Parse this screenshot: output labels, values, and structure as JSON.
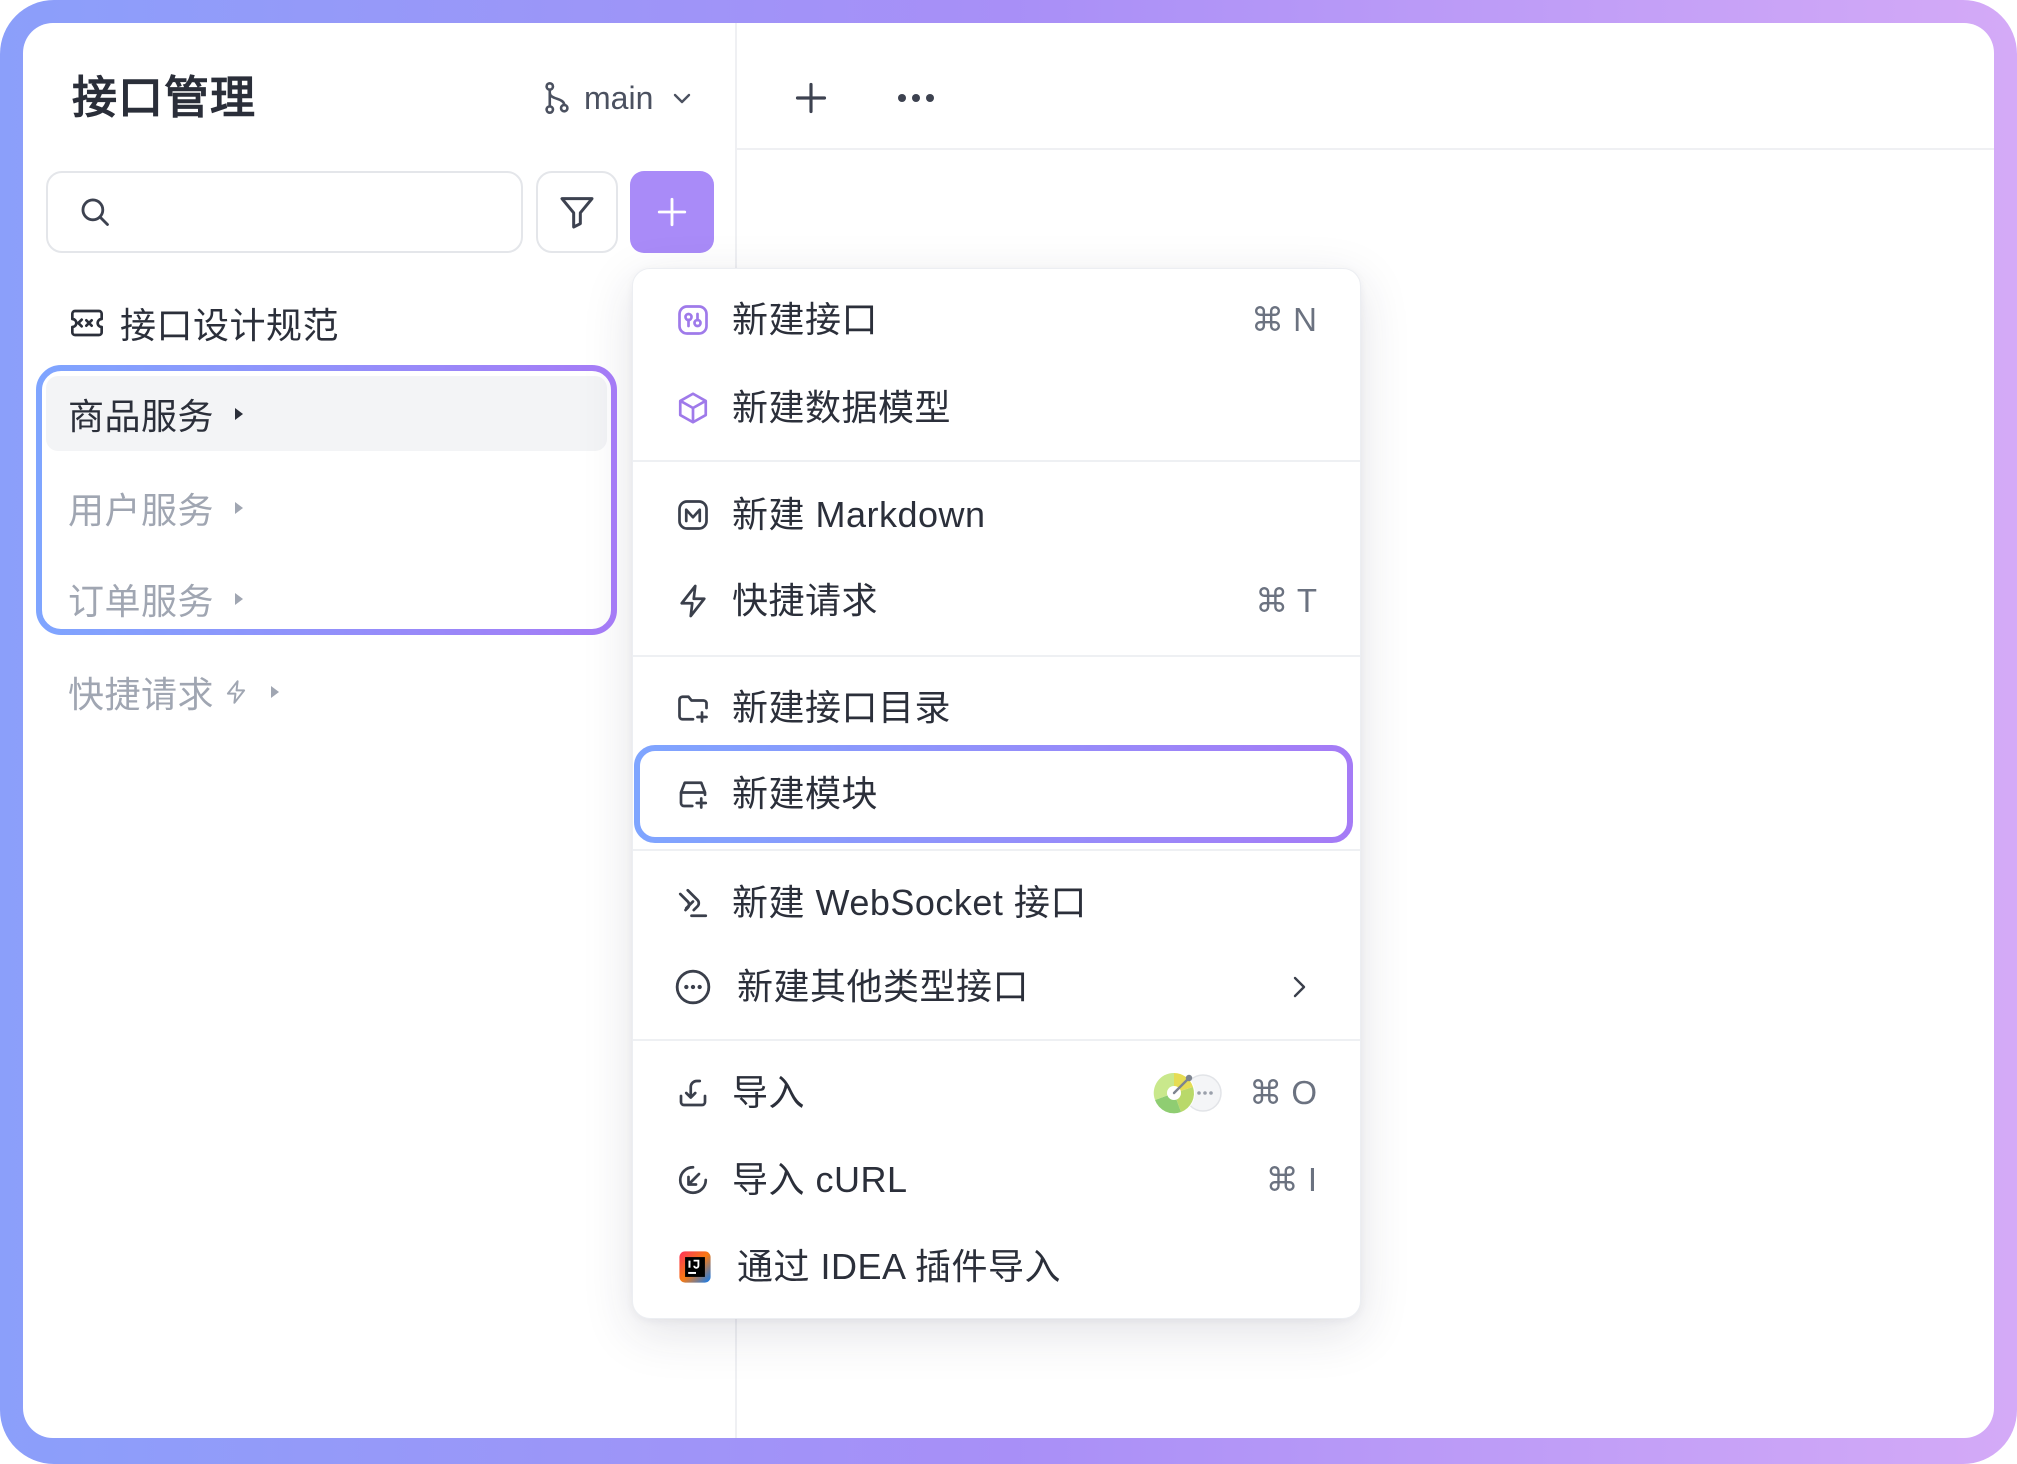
{
  "colors": {
    "frame_start": "#8b9ffa",
    "frame_mid": "#a88ff7",
    "frame_end": "#d4aaf7",
    "accent": "#a98bf8",
    "highlight_start": "#7fa5ff",
    "highlight_end": "#a57bf6",
    "text_primary": "#2b2f3a",
    "text_muted": "#a0a6b2",
    "icon_purple": "#9f7aea"
  },
  "sidebar": {
    "title": "接口管理",
    "branch": {
      "name": "main",
      "icon": "git-branch-icon"
    },
    "search": {
      "value": "",
      "placeholder": "",
      "icon": "search-icon"
    },
    "filter_button": {
      "icon": "filter-icon"
    },
    "add_button": {
      "icon": "plus-icon"
    },
    "spec_item": {
      "label": "接口设计规范",
      "icon": "api-spec-icon"
    },
    "groups": [
      {
        "label": "商品服务",
        "selected": true,
        "icon": "caret-right-icon"
      },
      {
        "label": "用户服务",
        "selected": false,
        "icon": "caret-right-icon"
      },
      {
        "label": "订单服务",
        "selected": false,
        "icon": "caret-right-icon"
      }
    ],
    "quick_request": {
      "label": "快捷请求",
      "icon": "bolt-icon"
    }
  },
  "header": {
    "new_tab_icon": "plus-icon",
    "more_icon": "more-dots-icon"
  },
  "new_menu": {
    "items": [
      {
        "label": "新建接口",
        "icon": "api-icon",
        "shortcut": "⌘ N"
      },
      {
        "label": "新建数据模型",
        "icon": "data-model-icon"
      },
      {
        "label": "新建 Markdown",
        "icon": "markdown-icon"
      },
      {
        "label": "快捷请求",
        "icon": "bolt-icon",
        "shortcut": "⌘ T"
      },
      {
        "label": "新建接口目录",
        "icon": "folder-plus-icon"
      },
      {
        "label": "新建模块",
        "icon": "module-plus-icon",
        "highlighted": true
      },
      {
        "label": "新建 WebSocket 接口",
        "icon": "websocket-icon"
      },
      {
        "label": "新建其他类型接口",
        "icon": "more-circle-icon",
        "submenu_icon": "chevron-right-icon"
      },
      {
        "label": "导入",
        "icon": "import-icon",
        "shortcut": "⌘ O",
        "badge_icon": "import-sources-icon"
      },
      {
        "label": "导入 cURL",
        "icon": "curl-icon",
        "shortcut": "⌘ I"
      },
      {
        "label": "通过 IDEA 插件导入",
        "icon": "intellij-idea-icon"
      }
    ]
  }
}
